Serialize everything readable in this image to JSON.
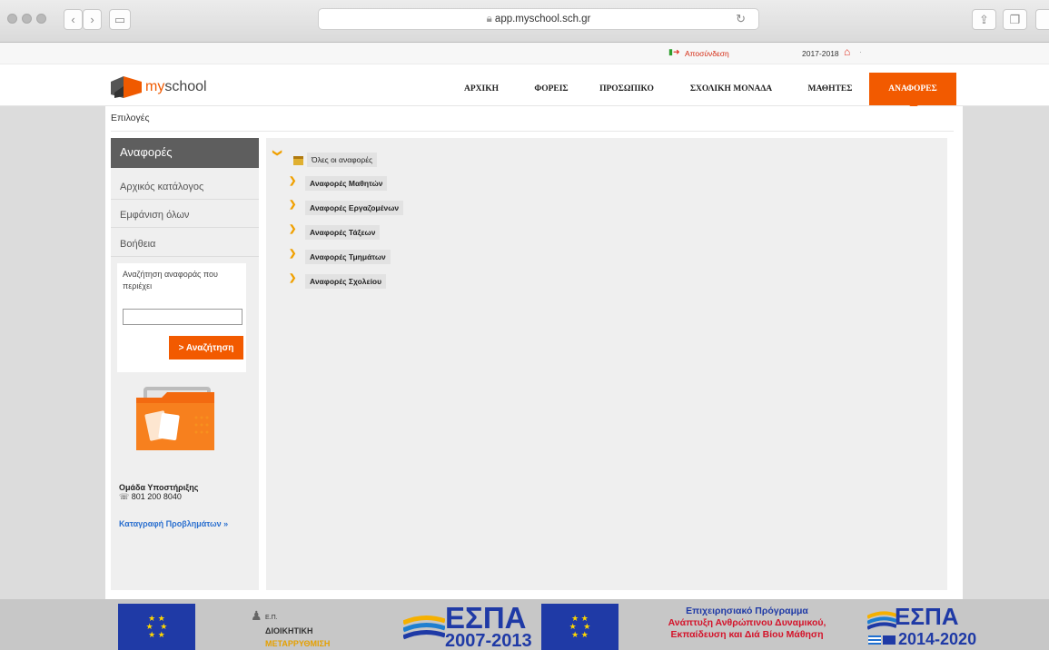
{
  "browser": {
    "url": "app.myschool.sch.gr"
  },
  "topbar": {
    "logout_label": "Αποσύνδεση",
    "year": "2017-2018"
  },
  "header": {
    "logo_prefix": "my",
    "logo_suffix": "school",
    "menu": [
      {
        "label": "ΑΡΧΙΚΗ"
      },
      {
        "label": "ΦΟΡΕΙΣ"
      },
      {
        "label": "ΠΡΟΣΩΠΙΚΟ"
      },
      {
        "label": "ΣΧΟΛΙΚΗ ΜΟΝΑΔΑ"
      },
      {
        "label": "ΜΑΘΗΤΕΣ"
      },
      {
        "label": "ΑΝΑΦΟΡΕΣ"
      }
    ],
    "active_menu": "ΑΝΑΦΟΡΕΣ"
  },
  "options_label": "Επιλογές",
  "sidebar": {
    "title": "Αναφορές",
    "items": [
      {
        "label": "Αρχικός κατάλογος"
      },
      {
        "label": "Εμφάνιση όλων"
      },
      {
        "label": "Βοήθεια"
      }
    ],
    "search": {
      "label": "Αναζήτηση αναφοράς που περιέχει",
      "value": "",
      "button_label": "> Αναζήτηση"
    },
    "support": {
      "title": "Ομάδα Υποστήριξης",
      "phone": "801 200 8040",
      "link_label": "Καταγραφή Προβλημάτων »"
    }
  },
  "tree": {
    "root": "Όλες οι αναφορές",
    "children": [
      {
        "label": "Αναφορές Μαθητών"
      },
      {
        "label": "Αναφορές Εργαζομένων"
      },
      {
        "label": "Αναφορές Τάξεων"
      },
      {
        "label": "Αναφορές Τμημάτων"
      },
      {
        "label": "Αναφορές Σχολείου"
      }
    ]
  },
  "footer": {
    "ep_prefix": "Ε.Π.",
    "ep_line1": "ΔΙΟΙΚΗΤΙΚΗ",
    "ep_line2": "ΜΕΤΑΡΡΥΘΜΙΣΗ",
    "espa_label": "ΕΣΠΑ",
    "espa1_years": "2007-2013",
    "program_lines": [
      "Επιχειρησιακό Πρόγραμμα",
      "Ανάπτυξη Ανθρώπινου Δυναμικού,",
      "Εκπαίδευση και Διά Βίου Μάθηση"
    ],
    "espa2_years": "2014-2020"
  },
  "colors": {
    "accent": "#f25a00",
    "sidebar_header": "#5e5e5e",
    "link": "#2a6fcf",
    "tree_arrow": "#f0a000"
  }
}
